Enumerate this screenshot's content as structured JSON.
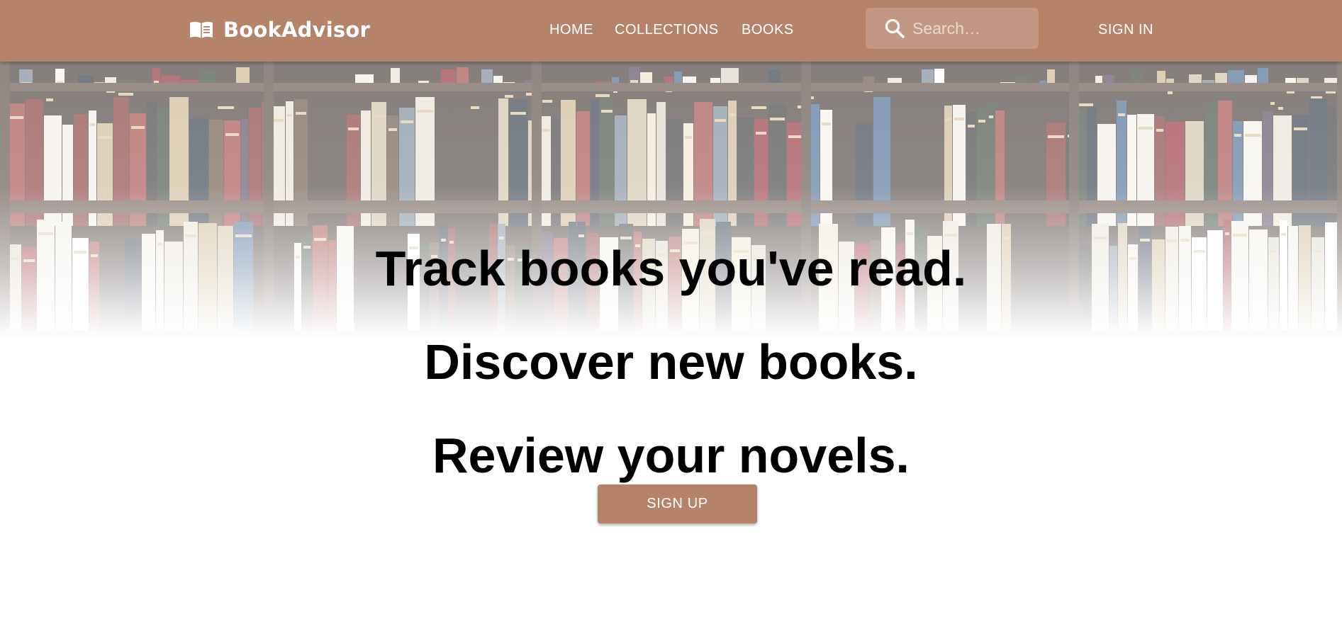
{
  "header": {
    "brand": {
      "icon": "book-open-icon",
      "name": "BookAdvisor"
    },
    "nav": {
      "home": "HOME",
      "collections": "COLLECTIONS",
      "books": "BOOKS"
    },
    "search": {
      "icon": "search-icon",
      "placeholder": "Search…"
    },
    "sign_in": "SIGN IN"
  },
  "hero": {
    "background": "bookshelf-photo",
    "lines": [
      "Track books you've read.",
      "Discover new books.",
      "Review your novels."
    ],
    "cta": "SIGN UP"
  },
  "colors": {
    "brand": "#b5826a",
    "header_text": "#ffffff",
    "headline_text": "#000000"
  }
}
